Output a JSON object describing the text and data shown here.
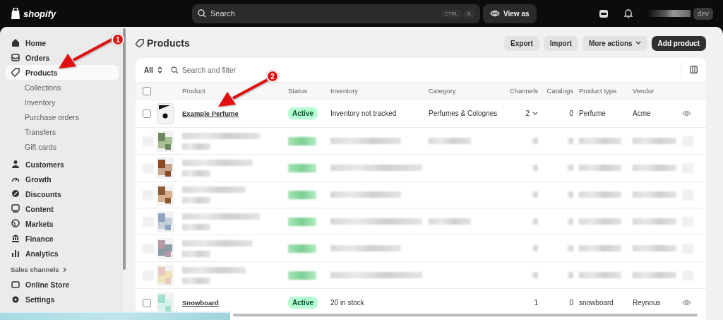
{
  "topbar": {
    "logo": "shopify",
    "search": {
      "placeholder": "Search",
      "shortcut": [
        "CTRL",
        "K"
      ]
    },
    "view_as": "View as",
    "store_badge": "dev"
  },
  "sidebar": {
    "items": [
      {
        "label": "Home",
        "selected": false,
        "sub": false
      },
      {
        "label": "Orders",
        "selected": false,
        "sub": false
      },
      {
        "label": "Products",
        "selected": true,
        "sub": false
      },
      {
        "label": "Collections",
        "selected": false,
        "sub": true
      },
      {
        "label": "Inventory",
        "selected": false,
        "sub": true
      },
      {
        "label": "Purchase orders",
        "selected": false,
        "sub": true
      },
      {
        "label": "Transfers",
        "selected": false,
        "sub": true
      },
      {
        "label": "Gift cards",
        "selected": false,
        "sub": true
      },
      {
        "label": "Customers",
        "selected": false,
        "sub": false
      },
      {
        "label": "Growth",
        "selected": false,
        "sub": false
      },
      {
        "label": "Discounts",
        "selected": false,
        "sub": false
      },
      {
        "label": "Content",
        "selected": false,
        "sub": false
      },
      {
        "label": "Markets",
        "selected": false,
        "sub": false
      },
      {
        "label": "Finance",
        "selected": false,
        "sub": false
      },
      {
        "label": "Analytics",
        "selected": false,
        "sub": false
      }
    ],
    "section": "Sales channels",
    "channel": "Online Store",
    "settings": "Settings"
  },
  "page": {
    "title": "Products",
    "buttons": [
      {
        "label": "Export",
        "kind": "secondary"
      },
      {
        "label": "Import",
        "kind": "secondary"
      },
      {
        "label": "More actions",
        "kind": "menu"
      },
      {
        "label": "Add product",
        "kind": "primary"
      }
    ]
  },
  "filter": {
    "view": "All",
    "placeholder": "Search and filter"
  },
  "table": {
    "header_checked": false,
    "columns": [
      "Product",
      "Status",
      "Inventory",
      "Category",
      "Channels",
      "Catalogs",
      "Product type",
      "Vendor"
    ],
    "rows": [
      {
        "kind": "product",
        "checked": false,
        "product": "Example Perfume",
        "status": "Active",
        "inventory": "Inventory not tracked",
        "category": "Perfumes & Colognes",
        "channels": "2",
        "catalogs": "0",
        "product_type": "Perfume",
        "vendor": "Acme"
      },
      {
        "kind": "blurred"
      },
      {
        "kind": "blurred"
      },
      {
        "kind": "blurred"
      },
      {
        "kind": "blurred"
      },
      {
        "kind": "blurred"
      },
      {
        "kind": "blurred"
      },
      {
        "kind": "product",
        "checked": false,
        "product": "Snowboard",
        "status": "Active",
        "inventory": "20 in stock",
        "channels": "1",
        "catalogs": "0",
        "product_type": "snowboard",
        "vendor": "Reynous"
      }
    ]
  },
  "annotations": [
    {
      "label": "1"
    },
    {
      "label": "2"
    }
  ]
}
